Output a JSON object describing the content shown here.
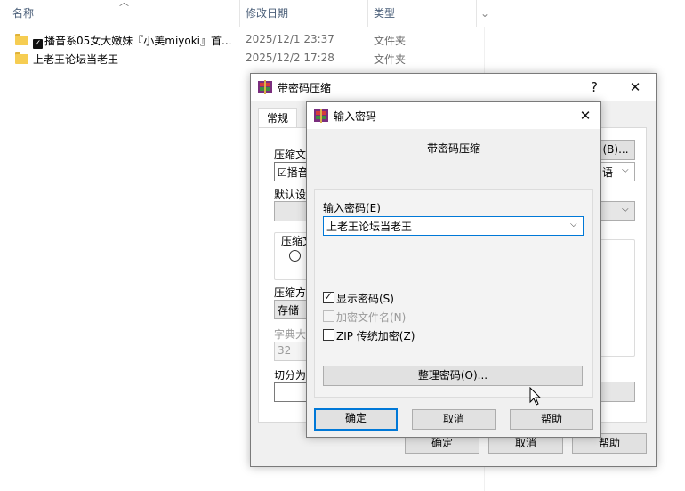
{
  "explorer": {
    "columns": {
      "name": "名称",
      "date": "修改日期",
      "type": "类型"
    },
    "rows": [
      {
        "name": "播音系05女大嫩妹『小美miyoki』首...",
        "date": "2025/12/1 23:37",
        "type": "文件夹",
        "checked_icon": "checkbox-emoji-icon"
      },
      {
        "name": "上老王论坛当老王",
        "date": "2025/12/2 17:28",
        "type": "文件夹"
      }
    ]
  },
  "archive_dialog": {
    "title": "带密码压缩",
    "help_glyph": "?",
    "close_glyph": "✕",
    "tabs": {
      "general": "常规"
    },
    "labels": {
      "archive_name": "压缩文",
      "default_profile": "默认设",
      "archive_format": "压缩文",
      "compression_method": "压缩方",
      "dictionary_size": "字典大",
      "split_volumes": "切分为"
    },
    "values": {
      "archive_name": "☑播音",
      "compression_method": "存储",
      "dictionary_size": "32"
    },
    "browse_button": "(B)...",
    "language_dropdown": "语",
    "buttons": {
      "ok": "确定",
      "cancel": "取消",
      "help": "帮助"
    }
  },
  "password_dialog": {
    "title": "输入密码",
    "close_glyph": "✕",
    "heading": "带密码压缩",
    "password_label": "输入密码(E)",
    "password_value": "上老王论坛当老王",
    "options": [
      {
        "label": "显示密码(S)",
        "checked": true,
        "enabled": true
      },
      {
        "label": "加密文件名(N)",
        "checked": false,
        "enabled": false
      },
      {
        "label": "ZIP 传统加密(Z)",
        "checked": false,
        "enabled": true
      }
    ],
    "organize_button": "整理密码(O)...",
    "buttons": {
      "ok": "确定",
      "cancel": "取消",
      "help": "帮助"
    }
  }
}
